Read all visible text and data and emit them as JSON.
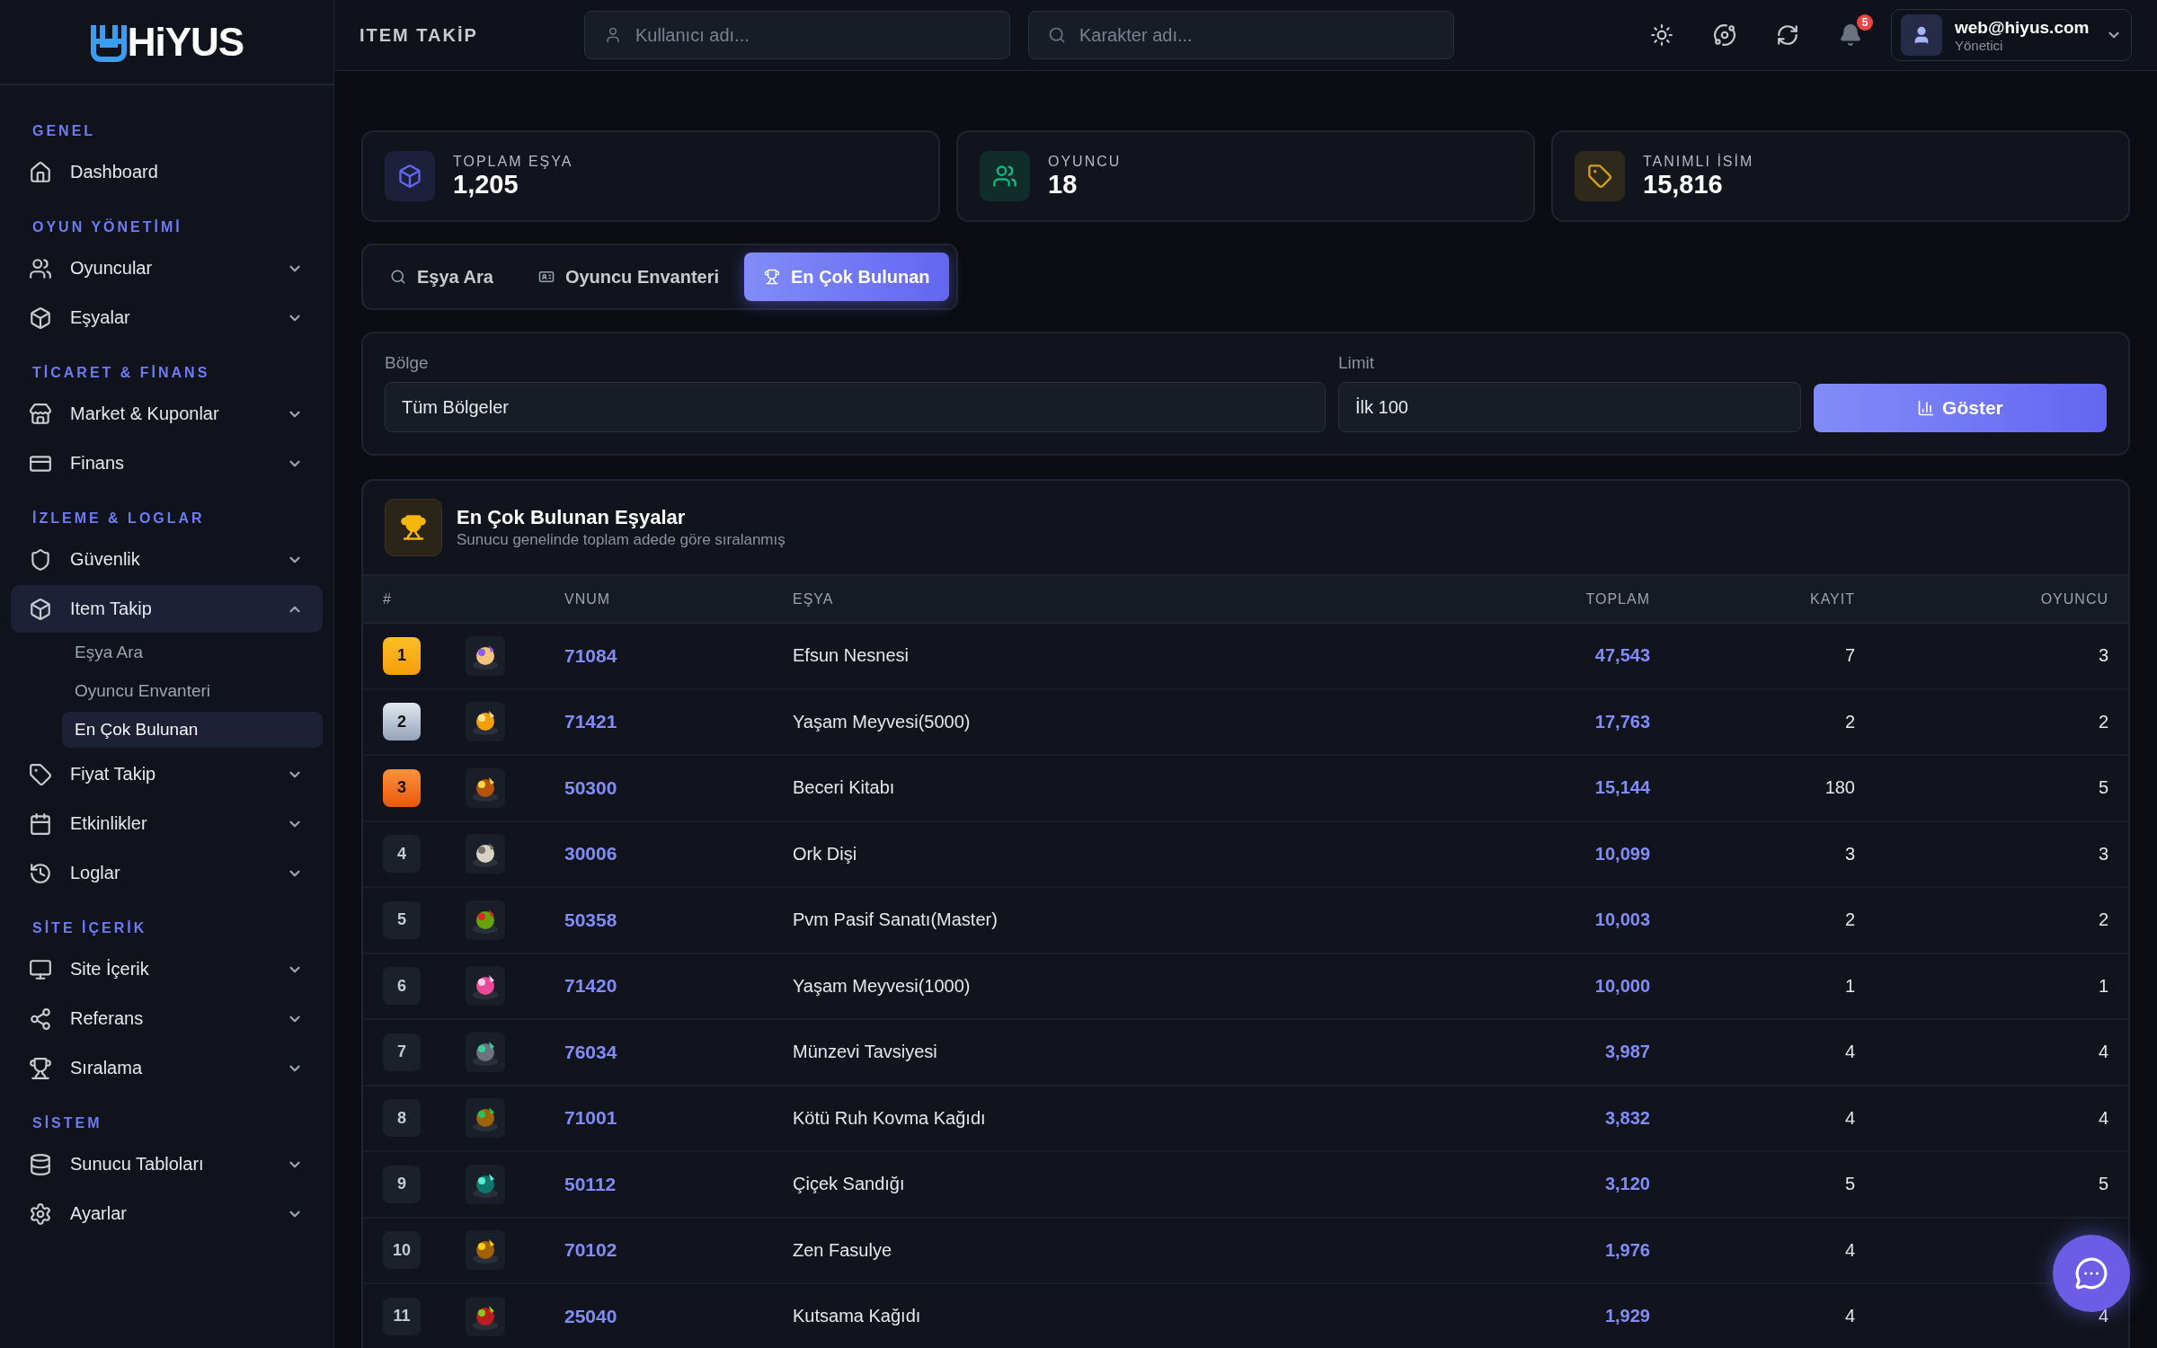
{
  "logo": "HiYUS",
  "sidebar": {
    "sections": [
      {
        "title": "GENEL",
        "items": [
          {
            "label": "Dashboard",
            "selected": false
          }
        ]
      },
      {
        "title": "OYUN YÖNETİMİ",
        "items": [
          {
            "label": "Oyuncular",
            "expanded": false,
            "selected": false
          },
          {
            "label": "Eşyalar",
            "expanded": false,
            "selected": false
          }
        ]
      },
      {
        "title": "TİCARET & FİNANS",
        "items": [
          {
            "label": "Market & Kuponlar",
            "expanded": false,
            "selected": false
          },
          {
            "label": "Finans",
            "expanded": false,
            "selected": false
          }
        ]
      },
      {
        "title": "İZLEME & LOGLAR",
        "items": [
          {
            "label": "Güvenlik",
            "expanded": false,
            "selected": false
          },
          {
            "label": "Item Takip",
            "expanded": true,
            "selected": true,
            "children": [
              {
                "label": "Eşya Ara",
                "selected": false
              },
              {
                "label": "Oyuncu Envanteri",
                "selected": false
              },
              {
                "label": "En Çok Bulunan",
                "selected": true
              }
            ]
          },
          {
            "label": "Fiyat Takip",
            "expanded": false,
            "selected": false
          },
          {
            "label": "Etkinlikler",
            "expanded": false,
            "selected": false
          },
          {
            "label": "Loglar",
            "expanded": false,
            "selected": false
          }
        ]
      },
      {
        "title": "SİTE İÇERİK",
        "items": [
          {
            "label": "Site İçerik",
            "expanded": false,
            "selected": false
          },
          {
            "label": "Referans",
            "expanded": false,
            "selected": false
          },
          {
            "label": "Sıralama",
            "expanded": false,
            "selected": false
          }
        ]
      },
      {
        "title": "SİSTEM",
        "items": [
          {
            "label": "Sunucu Tabloları",
            "expanded": false,
            "selected": false
          },
          {
            "label": "Ayarlar",
            "expanded": false,
            "selected": false
          }
        ]
      }
    ]
  },
  "header": {
    "title": "ITEM TAKİP",
    "search_user": {
      "placeholder": "Kullanıcı adı..."
    },
    "search_character": {
      "placeholder": "Karakter adı..."
    },
    "notification_count": "5",
    "user": {
      "email": "web@hiyus.com",
      "role": "Yönetici"
    }
  },
  "stats": [
    {
      "label": "TOPLAM EŞYA",
      "value": "1,205",
      "color": "#6366f1"
    },
    {
      "label": "OYUNCU",
      "value": "18",
      "color": "#10b981"
    },
    {
      "label": "TANIMLI İSİM",
      "value": "15,816",
      "color": "#d4a017"
    }
  ],
  "tabs": [
    {
      "label": "Eşya Ara",
      "selected": false
    },
    {
      "label": "Oyuncu Envanteri",
      "selected": false
    },
    {
      "label": "En Çok Bulunan",
      "selected": true
    }
  ],
  "filters": {
    "region": {
      "label": "Bölge",
      "value": "Tüm Bölgeler"
    },
    "limit": {
      "label": "Limit",
      "value": "İlk 100"
    },
    "button": "Göster"
  },
  "table": {
    "title": "En Çok Bulunan Eşyalar",
    "subtitle": "Sunucu genelinde toplam adede göre sıralanmış",
    "columns": [
      "#",
      "VNUM",
      "EŞYA",
      "TOPLAM",
      "KAYIT",
      "OYUNCU"
    ],
    "rows": [
      {
        "rank": "1",
        "kind": "gold",
        "vnum": "71084",
        "name": "Efsun Nesnesi",
        "total": "47,543",
        "records": "7",
        "players": "3"
      },
      {
        "rank": "2",
        "kind": "silver",
        "vnum": "71421",
        "name": "Yaşam Meyvesi(5000)",
        "total": "17,763",
        "records": "2",
        "players": "2"
      },
      {
        "rank": "3",
        "kind": "bronze",
        "vnum": "50300",
        "name": "Beceri Kitabı",
        "total": "15,144",
        "records": "180",
        "players": "5"
      },
      {
        "rank": "4",
        "kind": "plain",
        "vnum": "30006",
        "name": "Ork Dişi",
        "total": "10,099",
        "records": "3",
        "players": "3"
      },
      {
        "rank": "5",
        "kind": "plain",
        "vnum": "50358",
        "name": "Pvm Pasif Sanatı(Master)",
        "total": "10,003",
        "records": "2",
        "players": "2"
      },
      {
        "rank": "6",
        "kind": "plain",
        "vnum": "71420",
        "name": "Yaşam Meyvesi(1000)",
        "total": "10,000",
        "records": "1",
        "players": "1"
      },
      {
        "rank": "7",
        "kind": "plain",
        "vnum": "76034",
        "name": "Münzevi Tavsiyesi",
        "total": "3,987",
        "records": "4",
        "players": "4"
      },
      {
        "rank": "8",
        "kind": "plain",
        "vnum": "71001",
        "name": "Kötü Ruh Kovma Kağıdı",
        "total": "3,832",
        "records": "4",
        "players": "4"
      },
      {
        "rank": "9",
        "kind": "plain",
        "vnum": "50112",
        "name": "Çiçek Sandığı",
        "total": "3,120",
        "records": "5",
        "players": "5"
      },
      {
        "rank": "10",
        "kind": "plain",
        "vnum": "70102",
        "name": "Zen Fasulye",
        "total": "1,976",
        "records": "4"
      },
      {
        "rank": "11",
        "kind": "plain",
        "vnum": "25040",
        "name": "Kutsama Kağıdı",
        "total": "1,929",
        "records": "4",
        "players": "4"
      }
    ]
  }
}
